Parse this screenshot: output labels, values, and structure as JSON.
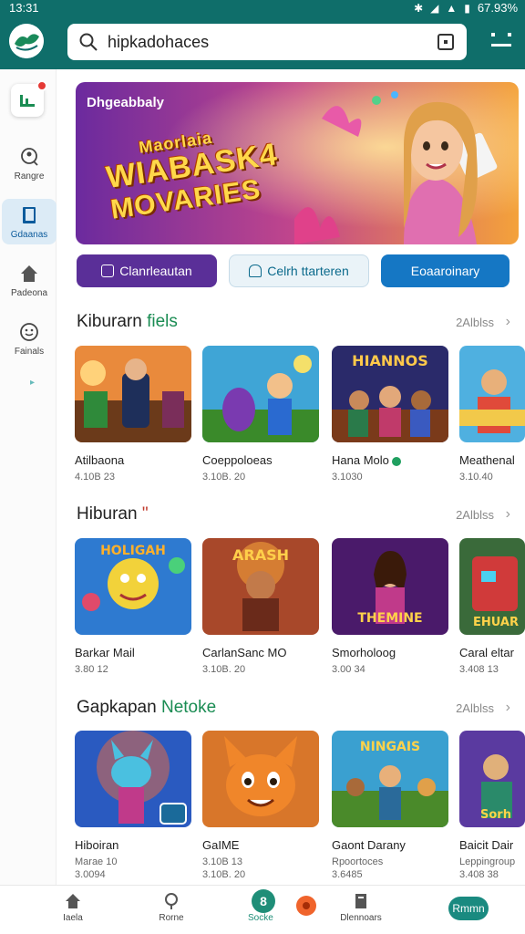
{
  "status_bar": {
    "time": "13:31",
    "battery": "67.93%"
  },
  "search": {
    "value": "hipkadohaces"
  },
  "sidebar": {
    "items": [
      {
        "label": "Rangre",
        "icon": "search-person-icon"
      },
      {
        "label": "Gdaanas",
        "icon": "book-icon"
      },
      {
        "label": "Padeona",
        "icon": "home-icon"
      },
      {
        "label": "Fainals",
        "icon": "smile-icon"
      }
    ]
  },
  "banner": {
    "label": "Dhgeabbaly",
    "title_top": "Maorlaia",
    "title_mid": "WIABASK4",
    "title_bot": "MOVARIES"
  },
  "actions": [
    {
      "label": "Clanrleautan"
    },
    {
      "label": "Celrh ttarteren"
    },
    {
      "label": "Eoaaroinary"
    }
  ],
  "sections": [
    {
      "title": "Kiburarn",
      "accent": "fiels",
      "more": "2Alblss",
      "cards": [
        {
          "name": "Atilbaona",
          "sub": "4.10B 23"
        },
        {
          "name": "Coeppoloeas",
          "sub": "3.10B. 20"
        },
        {
          "name": "Hana Molo",
          "sub": "3.1030",
          "badge": true
        },
        {
          "name": "Meathenal",
          "sub": "3.10.40"
        }
      ]
    },
    {
      "title": "Hiburan",
      "accent": "\"",
      "more": "2Alblss",
      "cards": [
        {
          "name": "Barkar Mail",
          "sub": "3.80 12"
        },
        {
          "name": "CarlanSanc MO",
          "sub": "3.10B. 20"
        },
        {
          "name": "Smorholoog",
          "sub": "3.00 34"
        },
        {
          "name": "Caral eltar",
          "sub": "3.408 13"
        }
      ]
    },
    {
      "title": "Gapkapan",
      "accent": "Netoke",
      "more": "2Alblss",
      "cards": [
        {
          "name": "Hiboiran",
          "sub": "Marae 10",
          "sub2": "3.0094"
        },
        {
          "name": "GaIME",
          "sub": "3.10B 13",
          "sub2": "3.10B. 20"
        },
        {
          "name": "Gaont Darany",
          "sub": "Rpoortoces",
          "sub2": "3.6485"
        },
        {
          "name": "Baicit Dair",
          "sub": "Leppingroup",
          "sub2": "3.408 38"
        }
      ]
    }
  ],
  "bottom_nav": {
    "items": [
      {
        "label": "Iaela"
      },
      {
        "label": "Rorne"
      },
      {
        "label": "Socke",
        "center_glyph": "8"
      },
      {
        "label": "Dlennoars"
      },
      {
        "label": "Rmmn"
      }
    ]
  },
  "colors": {
    "header": "#0f6e6a",
    "accent_green": "#1a8c53",
    "btn_purple": "#5a2f98",
    "btn_blue": "#1577c4"
  }
}
